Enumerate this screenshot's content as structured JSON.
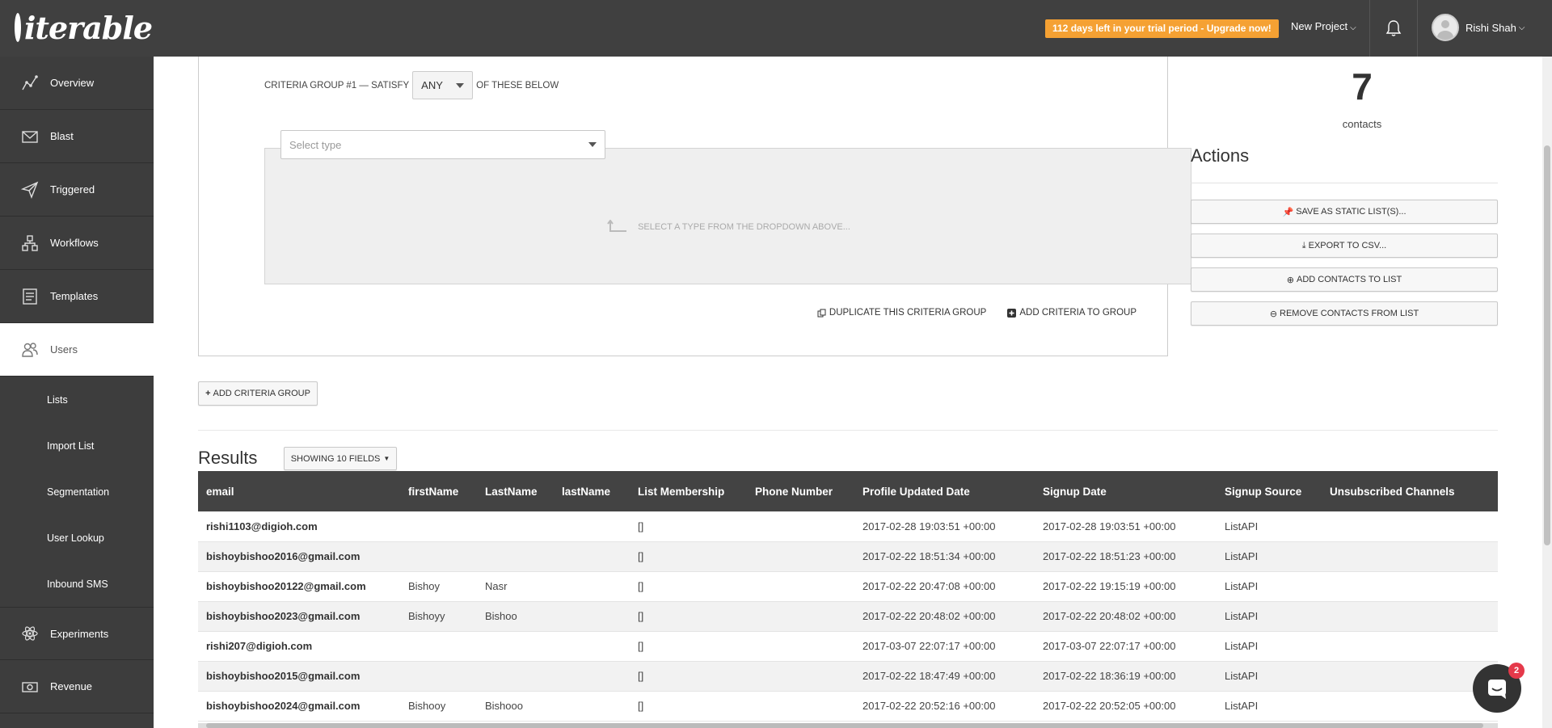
{
  "header": {
    "logo_text": "iterable",
    "trial_banner": "112 days left in your trial period - Upgrade now!",
    "project_label": "New Project",
    "user_name": "Rishi Shah"
  },
  "sidebar": {
    "items": [
      {
        "label": "Overview",
        "icon": "chart-line-icon"
      },
      {
        "label": "Blast",
        "icon": "envelope-icon"
      },
      {
        "label": "Triggered",
        "icon": "paper-plane-icon"
      },
      {
        "label": "Workflows",
        "icon": "workflow-icon"
      },
      {
        "label": "Templates",
        "icon": "template-icon"
      },
      {
        "label": "Users",
        "icon": "users-icon",
        "active": true
      }
    ],
    "sub_items": [
      "Lists",
      "Import List",
      "Segmentation",
      "User Lookup",
      "Inbound SMS"
    ],
    "bottom_items": [
      {
        "label": "Experiments",
        "icon": "atom-icon"
      },
      {
        "label": "Revenue",
        "icon": "money-icon"
      }
    ]
  },
  "criteria": {
    "group_prefix": "CRITERIA GROUP #1 — SATISFY",
    "match_value": "ANY",
    "group_suffix": "OF THESE BELOW",
    "type_placeholder": "Select type",
    "hint": "SELECT A TYPE FROM THE DROPDOWN ABOVE...",
    "duplicate_label": "DUPLICATE THIS CRITERIA GROUP",
    "add_criteria_label": "ADD CRITERIA TO GROUP",
    "add_group_label": "ADD CRITERIA GROUP"
  },
  "summary": {
    "count": "7",
    "count_label": "contacts",
    "actions_title": "Actions",
    "actions": [
      "SAVE AS STATIC LIST(S)...",
      "EXPORT TO CSV...",
      "ADD CONTACTS TO LIST",
      "REMOVE CONTACTS FROM LIST"
    ]
  },
  "results": {
    "title": "Results",
    "fields_button": "SHOWING 10 FIELDS",
    "columns": [
      "email",
      "firstName",
      "LastName",
      "lastName",
      "List Membership",
      "Phone Number",
      "Profile Updated Date",
      "Signup Date",
      "Signup Source",
      "Unsubscribed Channels"
    ],
    "rows": [
      [
        "rishi1103@digioh.com",
        "",
        "",
        "",
        "[]",
        "",
        "2017-02-28 19:03:51 +00:00",
        "2017-02-28 19:03:51 +00:00",
        "ListAPI",
        ""
      ],
      [
        "bishoybishoo2016@gmail.com",
        "",
        "",
        "",
        "[]",
        "",
        "2017-02-22 18:51:34 +00:00",
        "2017-02-22 18:51:23 +00:00",
        "ListAPI",
        ""
      ],
      [
        "bishoybishoo20122@gmail.com",
        "Bishoy",
        "Nasr",
        "",
        "[]",
        "",
        "2017-02-22 20:47:08 +00:00",
        "2017-02-22 19:15:19 +00:00",
        "ListAPI",
        ""
      ],
      [
        "bishoybishoo2023@gmail.com",
        "Bishoyy",
        "Bishoo",
        "",
        "[]",
        "",
        "2017-02-22 20:48:02 +00:00",
        "2017-02-22 20:48:02 +00:00",
        "ListAPI",
        ""
      ],
      [
        "rishi207@digioh.com",
        "",
        "",
        "",
        "[]",
        "",
        "2017-03-07 22:07:17 +00:00",
        "2017-03-07 22:07:17 +00:00",
        "ListAPI",
        ""
      ],
      [
        "bishoybishoo2015@gmail.com",
        "",
        "",
        "",
        "[]",
        "",
        "2017-02-22 18:47:49 +00:00",
        "2017-02-22 18:36:19 +00:00",
        "ListAPI",
        ""
      ],
      [
        "bishoybishoo2024@gmail.com",
        "Bishooy",
        "Bishooo",
        "",
        "[]",
        "",
        "2017-02-22 20:52:16 +00:00",
        "2017-02-22 20:52:05 +00:00",
        "ListAPI",
        ""
      ]
    ]
  },
  "chat": {
    "badge": "2"
  }
}
